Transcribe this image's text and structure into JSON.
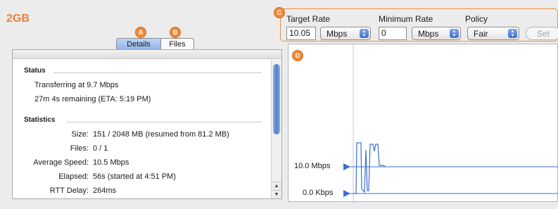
{
  "title": "2GB",
  "markers": {
    "a": "A",
    "b": "B",
    "c": "C",
    "d": "D"
  },
  "tabs": [
    {
      "label": "Details",
      "active": true
    },
    {
      "label": "Files",
      "active": false
    }
  ],
  "status": {
    "heading": "Status",
    "lines": [
      "Transferring at 9.7 Mbps",
      "27m 4s remaining (ETA: 5:19 PM)"
    ]
  },
  "statistics": {
    "heading": "Statistics",
    "rows": [
      {
        "label": "Size:",
        "value": "151 / 2048 MB (resumed from 81.2 MB)"
      },
      {
        "label": "Files:",
        "value": "0 / 1"
      },
      {
        "label": "Average Speed:",
        "value": "10.5 Mbps"
      },
      {
        "label": "Elapsed:",
        "value": "56s (started at 4:51 PM)"
      },
      {
        "label": "RTT Delay:",
        "value": "264ms"
      }
    ]
  },
  "rate_controls": {
    "target_rate_label": "Target Rate",
    "target_rate_value": "10.05",
    "target_rate_unit": "Mbps",
    "minimum_rate_label": "Minimum Rate",
    "minimum_rate_value": "0",
    "minimum_rate_unit": "Mbps",
    "policy_label": "Policy",
    "policy_value": "Fair",
    "set_label": "Set"
  },
  "graph": {
    "upper_label": "10.0 Mbps",
    "lower_label": "0.0 Kbps"
  },
  "colors": {
    "accent_orange": "#ee8a3a",
    "graph_line": "#3a6fd0",
    "selected_tab": "#9fc0ee"
  }
}
